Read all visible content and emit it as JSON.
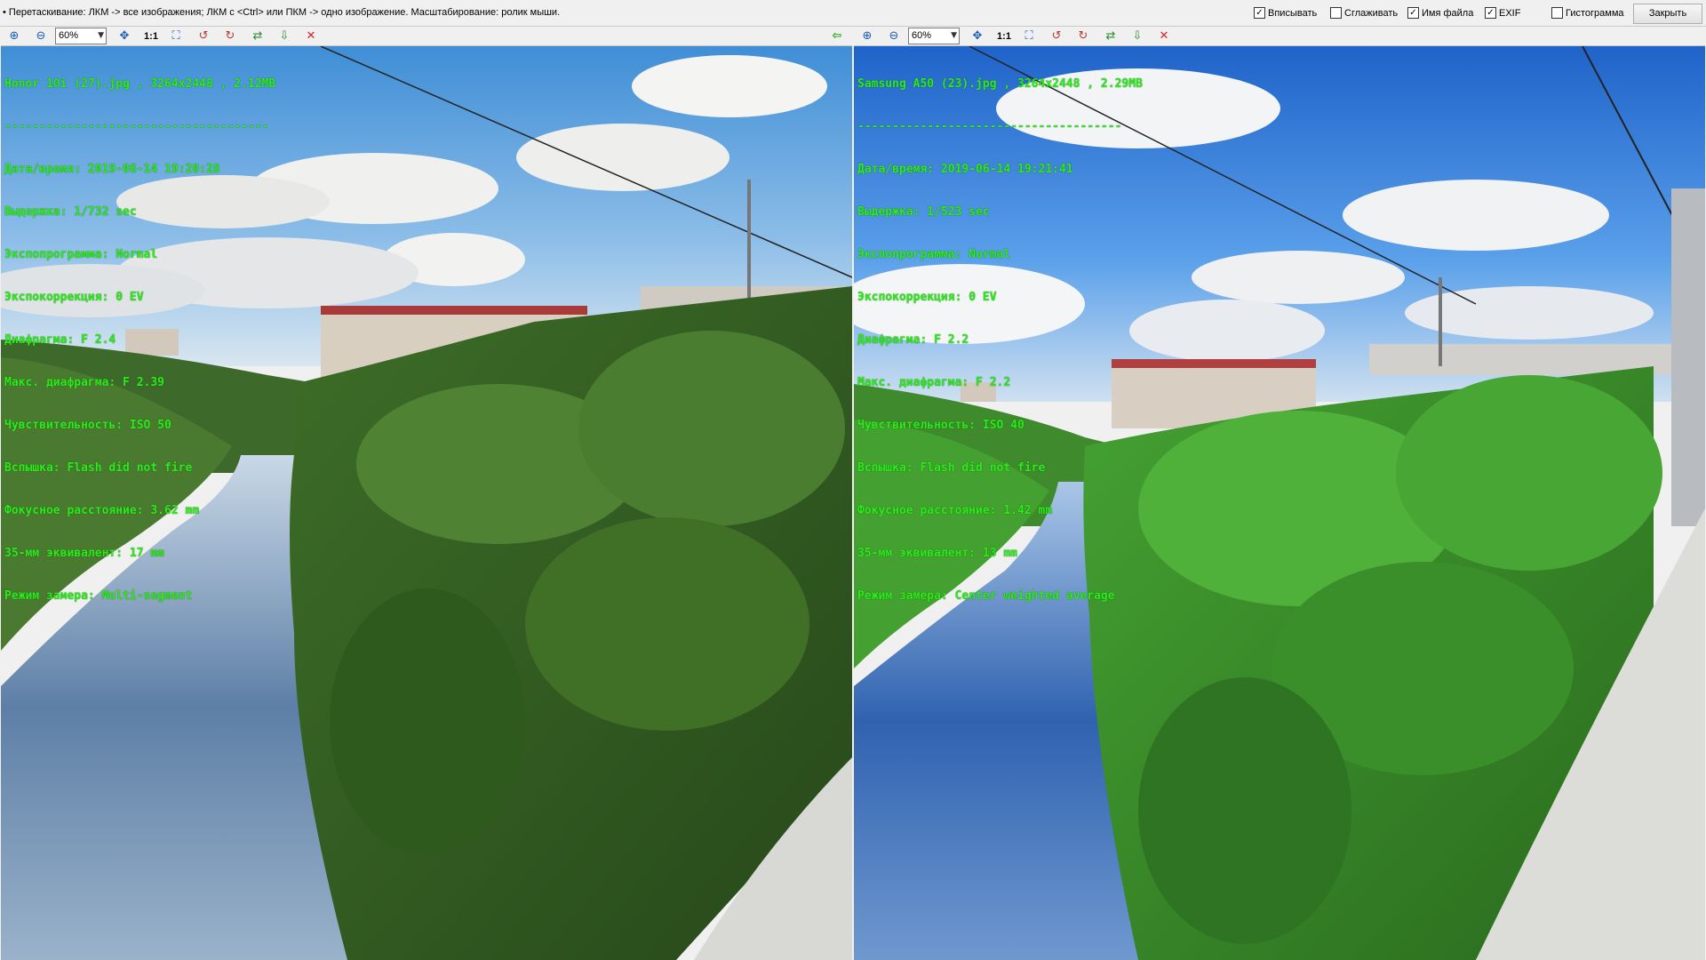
{
  "topbar": {
    "hint": "• Перетаскивание: ЛКМ -> все изображения; ЛКМ с <Ctrl> или ПКМ -> одно изображение. Масштабирование: ролик мыши.",
    "options": [
      {
        "label": "Вписывать",
        "checked": true
      },
      {
        "label": "Сглаживать",
        "checked": false
      },
      {
        "label": "Имя файла",
        "checked": true
      },
      {
        "label": "EXIF",
        "checked": true
      },
      {
        "label": "Гистограмма",
        "checked": false
      }
    ],
    "close_label": "Закрыть"
  },
  "panes": [
    {
      "zoom": "60%",
      "one_to_one": "1:1",
      "header": "Honor 10i (27).jpg , 3264x2448 , 2.12MB",
      "separator": "--------------------------------------",
      "exif": [
        "Дата/время: 2019-06-14 19:20:28",
        "Выдержка: 1/732 sec",
        "Экспопрограмма: Normal",
        "Экспокоррекция: 0 EV",
        "Диафрагма: F 2.4",
        "Макс. диафрагма: F 2.39",
        "Чувствительность: ISO 50",
        "Вспышка: Flash did not fire",
        "Фокусное расстояние: 3.62 mm",
        "35-мм эквивалент: 17 mm",
        "Режим замера: Multi-segment"
      ]
    },
    {
      "zoom": "60%",
      "one_to_one": "1:1",
      "header": "Samsung A50 (23).jpg , 3264x2448 , 2.29MB",
      "separator": "--------------------------------------",
      "exif": [
        "Дата/время: 2019-06-14 19:21:41",
        "Выдержка: 1/523 sec",
        "Экспопрограмма: Normal",
        "Экспокоррекция: 0 EV",
        "Диафрагма: F 2.2",
        "Макс. диафрагма: F 2.2",
        "Чувствительность: ISO 40",
        "Вспышка: Flash did not fire",
        "Фокусное расстояние: 1.42 mm",
        "35-мм эквивалент: 13 mm",
        "Режим замера: Center weighted average"
      ]
    }
  ],
  "icons": {
    "zoom_in": "zoom-in-icon",
    "zoom_out": "zoom-out-icon",
    "center": "center-icon",
    "fit": "fit-icon",
    "rotate_left": "rotate-left-icon",
    "rotate_right": "rotate-right-icon",
    "flip": "flip-icon",
    "save": "save-icon",
    "close": "close-icon",
    "back": "back-arrow-icon"
  },
  "colors": {
    "exif_text": "#2eea1e",
    "close_icon": "#e02020",
    "back_arrow": "#1ea01e"
  }
}
